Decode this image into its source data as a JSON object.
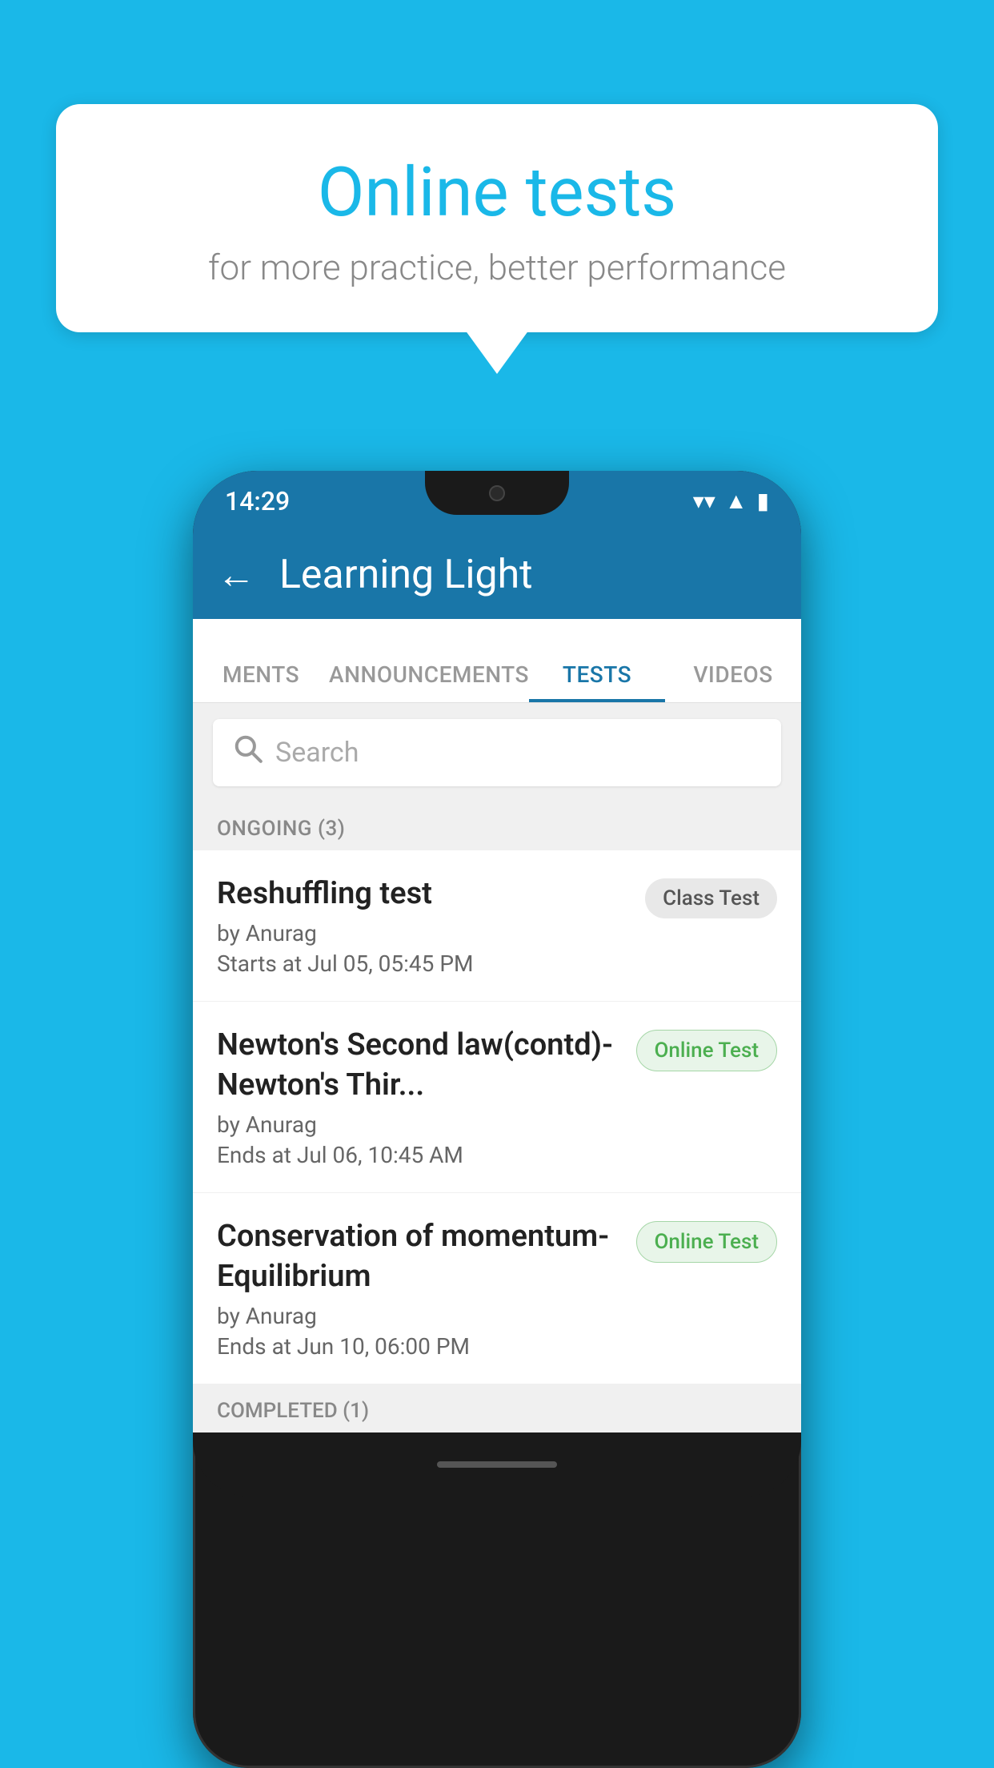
{
  "background_color": "#1ab8e8",
  "speech_bubble": {
    "title": "Online tests",
    "subtitle": "for more practice, better performance"
  },
  "phone": {
    "status_bar": {
      "time": "14:29"
    },
    "app_bar": {
      "title": "Learning Light",
      "back_label": "←"
    },
    "tabs": [
      {
        "label": "MENTS",
        "active": false
      },
      {
        "label": "ANNOUNCEMENTS",
        "active": false
      },
      {
        "label": "TESTS",
        "active": true
      },
      {
        "label": "VIDEOS",
        "active": false
      }
    ],
    "search": {
      "placeholder": "Search"
    },
    "ongoing_section": {
      "header": "ONGOING (3)",
      "tests": [
        {
          "name": "Reshuffling test",
          "author": "by Anurag",
          "time_label": "Starts at",
          "time": "Jul 05, 05:45 PM",
          "badge": "Class Test",
          "badge_type": "class"
        },
        {
          "name": "Newton's Second law(contd)-Newton's Thir...",
          "author": "by Anurag",
          "time_label": "Ends at",
          "time": "Jul 06, 10:45 AM",
          "badge": "Online Test",
          "badge_type": "online"
        },
        {
          "name": "Conservation of momentum-Equilibrium",
          "author": "by Anurag",
          "time_label": "Ends at",
          "time": "Jun 10, 06:00 PM",
          "badge": "Online Test",
          "badge_type": "online"
        }
      ]
    },
    "completed_section": {
      "header": "COMPLETED (1)"
    }
  }
}
